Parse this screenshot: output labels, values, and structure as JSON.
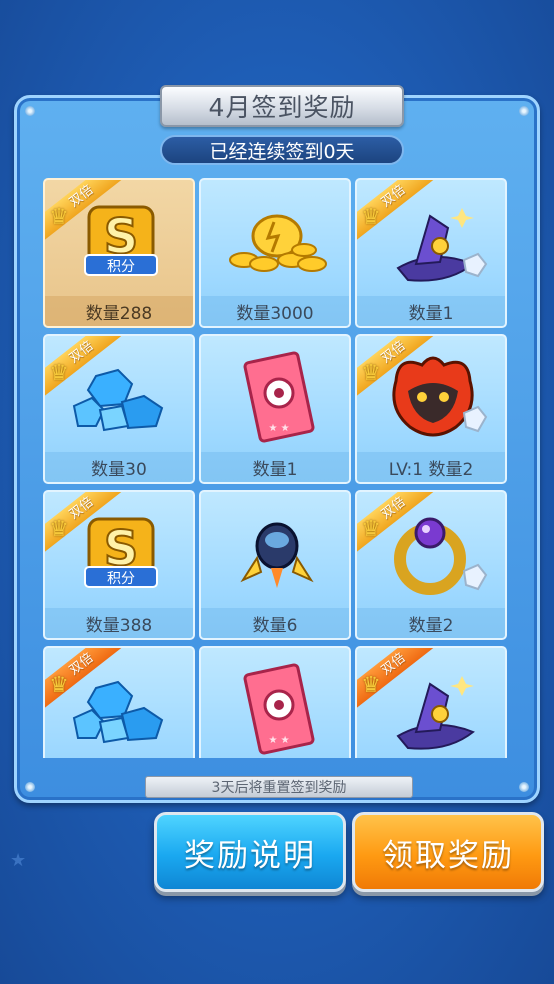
{
  "title": "4月签到奖励",
  "subtitle": "已经连续签到0天",
  "double_label": "双倍",
  "footer_note": "3天后将重置签到奖励",
  "buttons": {
    "explain": "奖励说明",
    "claim": "领取奖励"
  },
  "colors": {
    "accent_blue": "#1aa8f0",
    "accent_orange": "#ff9a12",
    "badge_gold": "#f0a51e",
    "badge_orange": "#ef6a12"
  },
  "rewards": [
    {
      "icon": "points-s-icon",
      "count": "数量288",
      "double": true,
      "claimed_style": true
    },
    {
      "icon": "gold-coins-icon",
      "count": "数量3000",
      "double": false
    },
    {
      "icon": "wizard-hat-icon",
      "count": "数量1",
      "double": true
    },
    {
      "icon": "blue-crystals-icon",
      "count": "数量30",
      "double": true
    },
    {
      "icon": "pink-card-icon",
      "count": "数量1",
      "double": false
    },
    {
      "icon": "fire-monster-icon",
      "count": "LV:1 数量2",
      "double": true
    },
    {
      "icon": "points-s-icon",
      "count": "数量388",
      "double": true
    },
    {
      "icon": "rocket-pod-icon",
      "count": "数量6",
      "double": false
    },
    {
      "icon": "gold-ring-icon",
      "count": "数量2",
      "double": true
    },
    {
      "icon": "blue-crystals-icon",
      "count": "",
      "double": true,
      "badge_orange": true
    },
    {
      "icon": "pink-card-icon",
      "count": "",
      "double": false
    },
    {
      "icon": "wizard-hat-icon",
      "count": "",
      "double": true,
      "badge_orange": true
    }
  ]
}
